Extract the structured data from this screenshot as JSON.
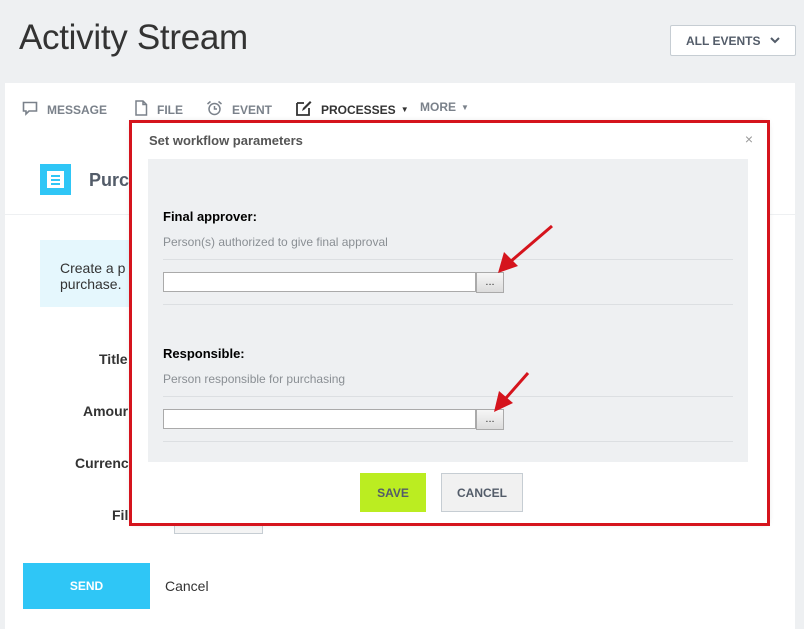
{
  "header": {
    "title": "Activity Stream",
    "events_filter_label": "ALL EVENTS"
  },
  "tabs": [
    {
      "label": "MESSAGE",
      "icon": "message-icon"
    },
    {
      "label": "FILE",
      "icon": "file-icon"
    },
    {
      "label": "EVENT",
      "icon": "alarm-clock-icon"
    },
    {
      "label": "PROCESSES",
      "icon": "edit-icon",
      "active": true
    },
    {
      "label": "MORE",
      "icon": "none"
    }
  ],
  "process": {
    "title": "Purc",
    "info_text": "Create a p purchase."
  },
  "form": {
    "labels": [
      "Title",
      "Amour",
      "Currenc",
      "Fil"
    ]
  },
  "footer": {
    "send_label": "SEND",
    "cancel_label": "Cancel"
  },
  "dialog": {
    "title": "Set workflow parameters",
    "close_glyph": "×",
    "fields": [
      {
        "label": "Final approver:",
        "description": "Person(s) authorized to give final approval",
        "value": "",
        "button_label": "..."
      },
      {
        "label": "Responsible:",
        "description": "Person responsible for purchasing",
        "value": "",
        "button_label": "..."
      }
    ],
    "save_label": "SAVE",
    "cancel_label": "CANCEL"
  },
  "colors": {
    "accent_blue": "#2fc6f6",
    "save_green": "#bbed21",
    "highlight_red": "#d5141d"
  }
}
